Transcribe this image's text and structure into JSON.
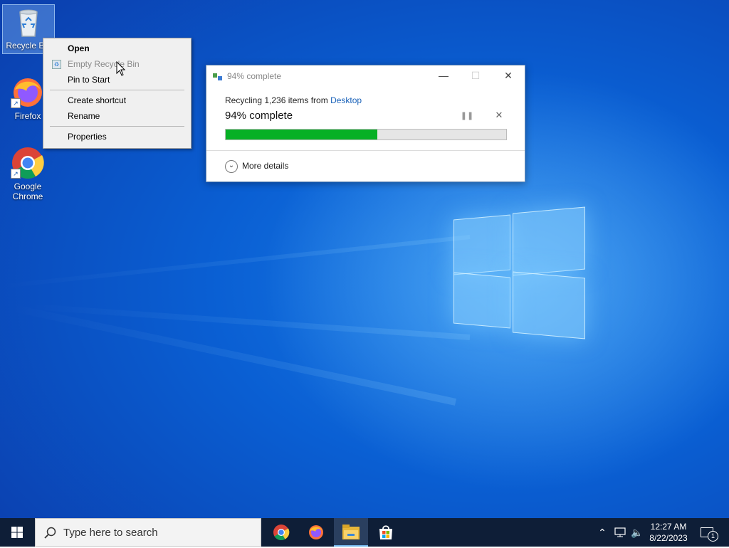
{
  "desktop": {
    "icons": [
      {
        "label": "Recycle Bin",
        "icon": "recycle-bin-icon"
      },
      {
        "label": "Firefox",
        "icon": "firefox-icon"
      },
      {
        "label": "Google Chrome",
        "icon": "chrome-icon"
      }
    ]
  },
  "context_menu": {
    "items": [
      {
        "label": "Open",
        "bold": true
      },
      {
        "label": "Empty Recycle Bin",
        "disabled": true,
        "icon": "recycle-small-icon"
      },
      {
        "label": "Pin to Start"
      },
      {
        "label": "Create shortcut"
      },
      {
        "label": "Rename"
      },
      {
        "label": "Properties"
      }
    ]
  },
  "progress_dialog": {
    "title": "94% complete",
    "recycling_prefix": "Recycling 1,236 items from ",
    "recycling_source": "Desktop",
    "percent_text": "94% complete",
    "progress_fraction": 0.54,
    "more_details": "More details",
    "colors": {
      "bar_fill": "#06b025",
      "link": "#1a62b9"
    }
  },
  "taskbar": {
    "search_placeholder": "Type here to search",
    "apps": [
      "chrome-icon",
      "firefox-icon",
      "file-explorer-icon",
      "microsoft-store-icon"
    ],
    "clock_time": "12:27 AM",
    "clock_date": "8/22/2023",
    "notification_count": "1"
  }
}
